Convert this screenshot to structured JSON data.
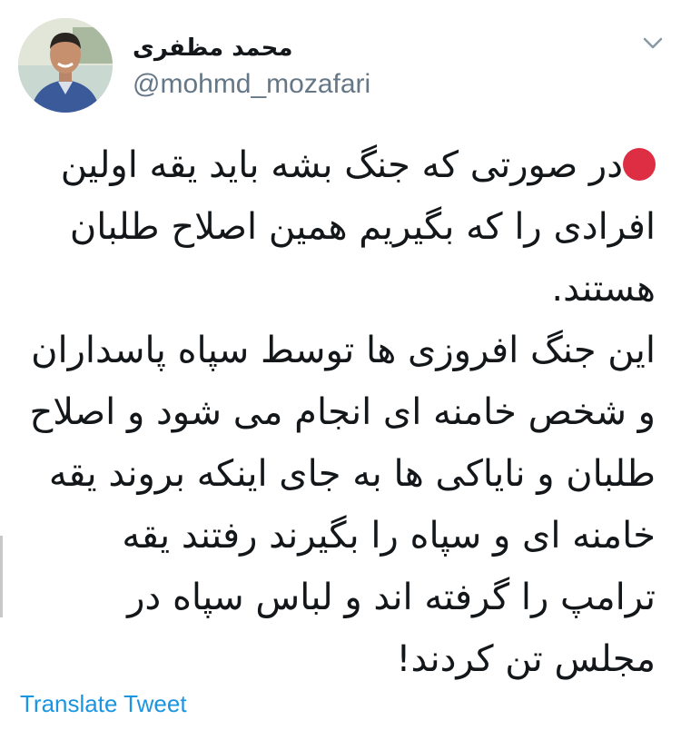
{
  "author": {
    "name": "محمد مظفری",
    "handle": "@mohmd_mozafari",
    "avatar_icon": "profile-photo-icon"
  },
  "menu": {
    "icon": "chevron-down-icon"
  },
  "tweet": {
    "status_icon": "red-circle-icon",
    "status_color": "#dd2e44",
    "text": "در صورتی که جنگ بشه باید یقه اولین افرادی را که بگیریم همین اصلاح طلبان هستند.\nاین جنگ افروزی ها توسط سپاه پاسداران و شخص خامنه ای انجام می شود و اصلاح طلبان و نایاکی ها به جای اینکه بروند یقه خامنه ای و سپاه را بگیرند رفتند یقه ترامپ را گرفته اند و لباس سپاه در مجلس تن کردند!"
  },
  "footer": {
    "translate_label": "Translate Tweet"
  },
  "colors": {
    "text": "#14171a",
    "secondary": "#657786",
    "link": "#1b95e0",
    "chevron": "#8899a6"
  }
}
